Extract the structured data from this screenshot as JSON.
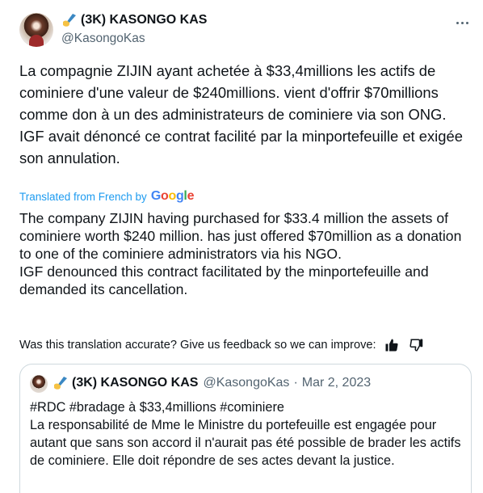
{
  "author": {
    "name": "(3K) KASONGO KAS",
    "handle": "@KasongoKas"
  },
  "tweet": {
    "text": "La compagnie ZIJIN ayant achetée à $33,4millions les actifs de cominiere d'une valeur de $240millions. vient d'offrir $70millions comme don à un des administrateurs de cominiere via son ONG.\nIGF avait dénoncé ce contrat facilité par la minportefeuille et exigée son annulation."
  },
  "translation": {
    "label": "Translated from French by",
    "provider": "Google",
    "text": "The company ZIJIN having purchased for $33.4 million the assets of cominiere worth $240 million. has just offered $70million as a donation to one of the cominiere administrators via his NGO.\nIGF denounced this contract facilitated by the minportefeuille and demanded its cancellation."
  },
  "feedback": {
    "question": "Was this translation accurate? Give us feedback so we can improve:"
  },
  "quoted": {
    "name": "(3K) KASONGO KAS",
    "handle": "@KasongoKas",
    "separator": "·",
    "date": "Mar 2, 2023",
    "text": "#RDC #bradage à $33,4millions #cominiere\nLa responsabilité de Mme le Ministre du portefeuille est engagée pour autant que sans son accord il n'aurait pas été possible de brader les actifs de cominiere. Elle doit répondre de ses actes devant la justice."
  },
  "colors": {
    "link": "#1d9bf0",
    "secondary_text": "#536471",
    "border": "#cfd9de"
  },
  "icons": [
    "writing-hand-icon",
    "more-icon",
    "thumbs-up-icon",
    "thumbs-down-icon"
  ]
}
